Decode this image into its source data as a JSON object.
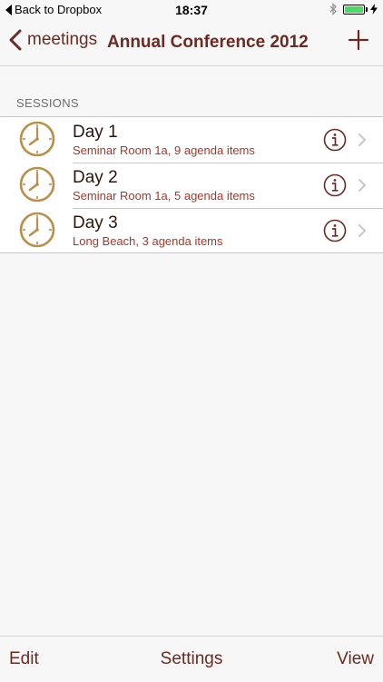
{
  "status": {
    "back_label": "Back to Dropbox",
    "time": "18:37",
    "battery_level": 1.0
  },
  "nav": {
    "back_label": "meetings",
    "title": "Annual Conference 2012",
    "add_icon": "plus-icon"
  },
  "section": {
    "header": "SESSIONS"
  },
  "sessions": [
    {
      "title": "Day 1",
      "subtitle": "Seminar Room 1a, 9 agenda items"
    },
    {
      "title": "Day 2",
      "subtitle": "Seminar Room 1a, 5 agenda items"
    },
    {
      "title": "Day 3",
      "subtitle": "Long Beach, 3 agenda items"
    }
  ],
  "toolbar": {
    "edit_label": "Edit",
    "settings_label": "Settings",
    "view_label": "View"
  },
  "colors": {
    "accent": "#6b2a22",
    "subtitle": "#a5382a",
    "clock_gold": "#b8904a",
    "battery_green": "#4cd964"
  }
}
